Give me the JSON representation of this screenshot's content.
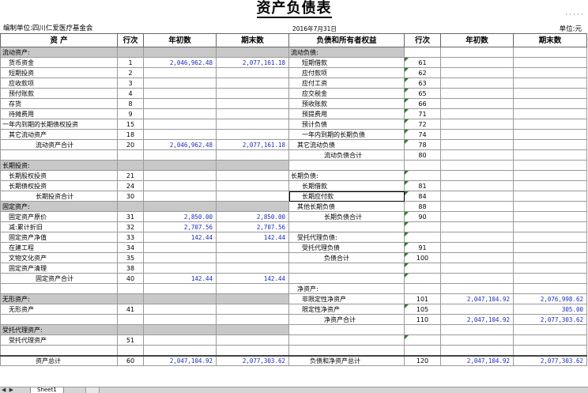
{
  "title": "资产负债表",
  "header": {
    "org": "编制单位:四川仁爱医疗基金会",
    "date": "2016年7月31日",
    "unit": "单位:元",
    "top_right_mark": "· · ·  · ·"
  },
  "columns": {
    "asset": "资  产",
    "line": "行次",
    "begin": "年初数",
    "end": "期末数",
    "liab": "负债和所有者权益",
    "line2": "行次",
    "begin2": "年初数",
    "end2": "期末数"
  },
  "rows": [
    {
      "a": "流动资产:",
      "an": "",
      "ab": "",
      "ae": "",
      "l": "流动负债:",
      "ln": "",
      "lb": "",
      "le": "",
      "a_sec": true,
      "l_sec": true
    },
    {
      "a": "货币资金",
      "an": "1",
      "ab": "2,046,962.48",
      "ae": "2,077,161.18",
      "l": "短期借款",
      "ln": "61",
      "lb": "",
      "le": ""
    },
    {
      "a": "短期投资",
      "an": "2",
      "ab": "",
      "ae": "",
      "l": "应付款项",
      "ln": "62",
      "lb": "",
      "le": ""
    },
    {
      "a": "应收款项",
      "an": "3",
      "ab": "",
      "ae": "",
      "l": "应付工资",
      "ln": "63",
      "lb": "",
      "le": ""
    },
    {
      "a": "预付账款",
      "an": "4",
      "ab": "",
      "ae": "",
      "l": "应交税金",
      "ln": "65",
      "lb": "",
      "le": ""
    },
    {
      "a": "存货",
      "an": "8",
      "ab": "",
      "ae": "",
      "l": "预收账款",
      "ln": "66",
      "lb": "",
      "le": ""
    },
    {
      "a": "待摊费用",
      "an": "9",
      "ab": "",
      "ae": "",
      "l": "预提费用",
      "ln": "71",
      "lb": "",
      "le": ""
    },
    {
      "a": "一年内到期的长期债权投资",
      "an": "15",
      "ab": "",
      "ae": "",
      "l": "预计负债",
      "ln": "72",
      "lb": "",
      "le": ""
    },
    {
      "a": "其它流动资产",
      "an": "18",
      "ab": "",
      "ae": "",
      "l": "一年内到期的长期负债",
      "ln": "74",
      "lb": "",
      "le": ""
    },
    {
      "a": "流动资产合计",
      "an": "20",
      "ab": "2,046,962.48",
      "ae": "2,077,161.18",
      "l": "其它流动负债",
      "ln": "78",
      "lb": "",
      "le": ""
    },
    {
      "a": "",
      "an": "",
      "ab": "",
      "ae": "",
      "l": "流动负债合计",
      "ln": "80",
      "lb": "",
      "le": ""
    },
    {
      "a": "长期投资:",
      "an": "",
      "ab": "",
      "ae": "",
      "l": "",
      "ln": "",
      "lb": "",
      "le": "",
      "a_sec": true
    },
    {
      "a": "长期股权投资",
      "an": "21",
      "ab": "",
      "ae": "",
      "l": "长期负债:",
      "ln": "",
      "lb": "",
      "le": ""
    },
    {
      "a": "长期债权投资",
      "an": "24",
      "ab": "",
      "ae": "",
      "l": "长期借款",
      "ln": "81",
      "lb": "",
      "le": ""
    },
    {
      "a": "长期投资合计",
      "an": "30",
      "ab": "",
      "ae": "",
      "l": "长期应付款",
      "ln": "84",
      "lb": "",
      "le": "",
      "l_sel": true
    },
    {
      "a": "固定资产:",
      "an": "",
      "ab": "",
      "ae": "",
      "l": "其他长期负债",
      "ln": "88",
      "lb": "",
      "le": "",
      "a_sec": true
    },
    {
      "a": "固定资产原价",
      "an": "31",
      "ab": "2,850.00",
      "ae": "2,850.00",
      "l": "长期负债合计",
      "ln": "90",
      "lb": "",
      "le": ""
    },
    {
      "a": "减:累计折旧",
      "an": "32",
      "ab": "2,707.56",
      "ae": "2,707.56",
      "l": "",
      "ln": "",
      "lb": "",
      "le": ""
    },
    {
      "a": "固定资产净值",
      "an": "33",
      "ab": "142.44",
      "ae": "142.44",
      "l": "受托代理负债:",
      "ln": "",
      "lb": "",
      "le": ""
    },
    {
      "a": "在建工程",
      "an": "34",
      "ab": "",
      "ae": "",
      "l": "受托代理负债",
      "ln": "91",
      "lb": "",
      "le": ""
    },
    {
      "a": "文物文化资产",
      "an": "35",
      "ab": "",
      "ae": "",
      "l": "负债合计",
      "ln": "100",
      "lb": "",
      "le": ""
    },
    {
      "a": "固定资产清理",
      "an": "38",
      "ab": "",
      "ae": "",
      "l": "",
      "ln": "",
      "lb": "",
      "le": ""
    },
    {
      "a": "固定资产合计",
      "an": "40",
      "ab": "142.44",
      "ae": "142.44",
      "l": "",
      "ln": "",
      "lb": "",
      "le": ""
    },
    {
      "a": "",
      "an": "",
      "ab": "",
      "ae": "",
      "l": "净资产:",
      "ln": "",
      "lb": "",
      "le": ""
    },
    {
      "a": "无形资产:",
      "an": "",
      "ab": "",
      "ae": "",
      "l": "非限定性净资产",
      "ln": "101",
      "lb": "2,047,104.92",
      "le": "2,076,998.62",
      "a_sec": true
    },
    {
      "a": "无形资产",
      "an": "41",
      "ab": "",
      "ae": "",
      "l": "限定性净资产",
      "ln": "105",
      "lb": "",
      "le": "305.00"
    },
    {
      "a": "",
      "an": "",
      "ab": "",
      "ae": "",
      "l": "净资产合计",
      "ln": "110",
      "lb": "2,047,104.92",
      "le": "2,077,303.62"
    },
    {
      "a": "受托代理资产:",
      "an": "",
      "ab": "",
      "ae": "",
      "l": "",
      "ln": "",
      "lb": "",
      "le": "",
      "a_sec": true
    },
    {
      "a": "受托代理资产",
      "an": "51",
      "ab": "",
      "ae": "",
      "l": "",
      "ln": "",
      "lb": "",
      "le": ""
    },
    {
      "a": "",
      "an": "",
      "ab": "",
      "ae": "",
      "l": "",
      "ln": "",
      "lb": "",
      "le": ""
    },
    {
      "a": "资产总计",
      "an": "60",
      "ab": "2,047,104.92",
      "ae": "2,077,303.62",
      "l": "负债和净资产总计",
      "ln": "120",
      "lb": "2,047,104.92",
      "le": "2,077,303.62",
      "total": true
    }
  ],
  "sheet_tabs": {
    "nav": "◀ ▶",
    "active": "Sheet1"
  }
}
